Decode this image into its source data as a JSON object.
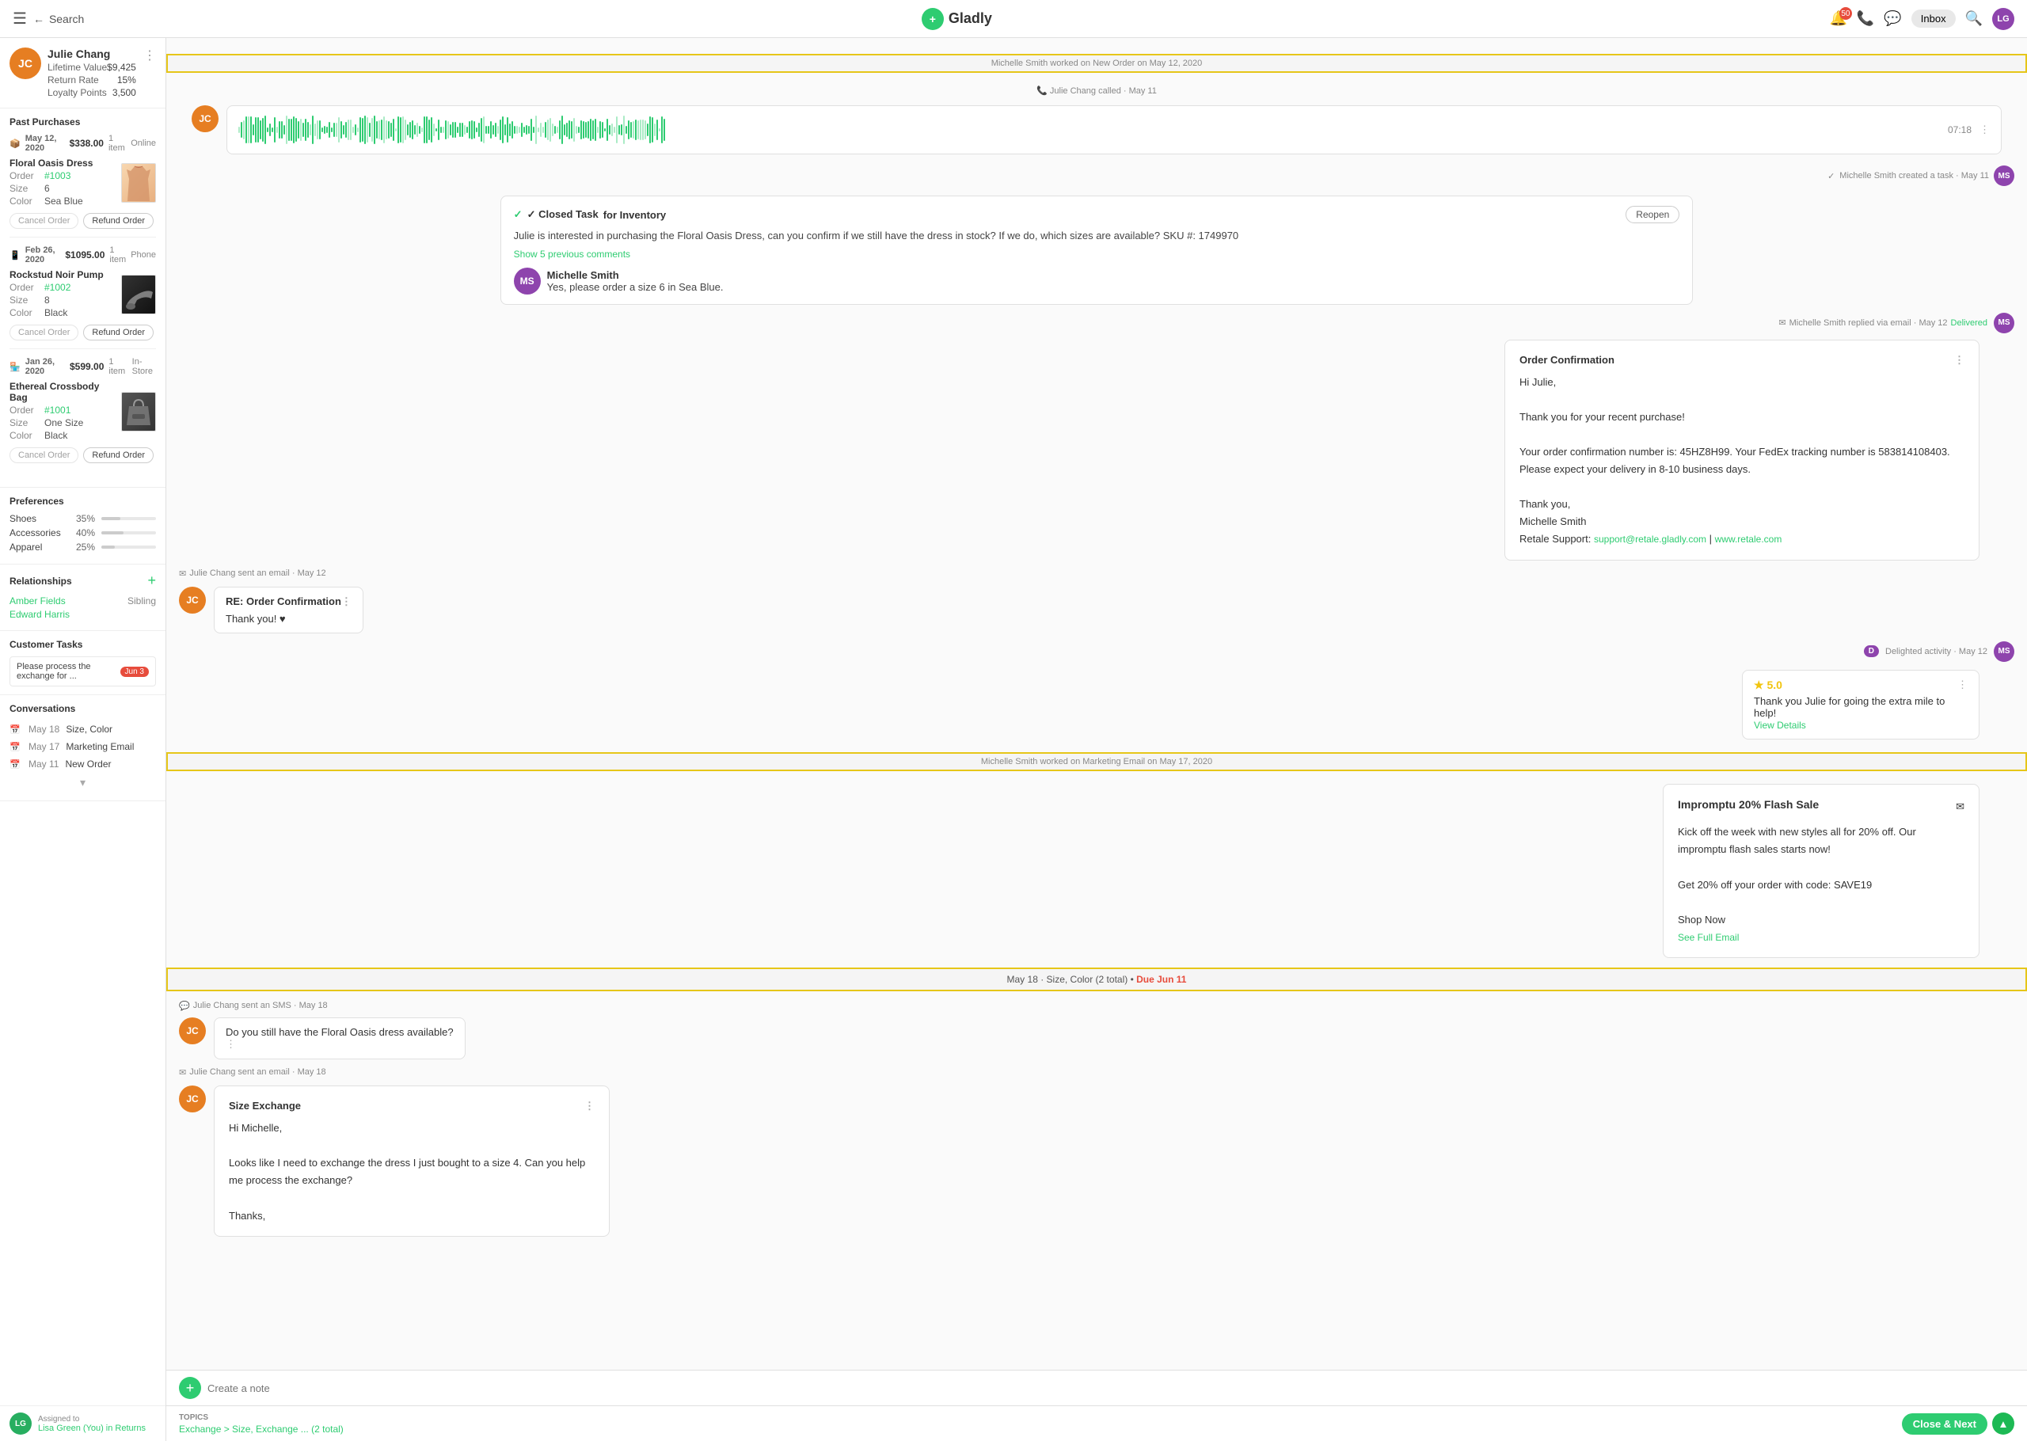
{
  "nav": {
    "hamburger": "☰",
    "search_label": "Search",
    "logo_text": "Gladly",
    "logo_icon": "+",
    "badge_count": "50",
    "inbox_label": "Inbox",
    "search_icon": "🔍"
  },
  "customer": {
    "name": "Julie Chang",
    "avatar_initials": "JC",
    "lifetime_value_label": "Lifetime Value",
    "lifetime_value": "$9,425",
    "return_rate_label": "Return Rate",
    "return_rate": "15%",
    "loyalty_label": "Loyalty Points",
    "loyalty": "3,500"
  },
  "past_purchases": {
    "title": "Past Purchases",
    "orders": [
      {
        "date": "May 12, 2020",
        "amount": "$338.00",
        "items": "1 item",
        "channel": "Online",
        "product": "Floral Oasis Dress",
        "order_label": "Order",
        "order_num": "#1003",
        "size_label": "Size",
        "size": "6",
        "color_label": "Color",
        "color": "Sea Blue",
        "cancel_label": "Cancel Order",
        "refund_label": "Refund Order"
      },
      {
        "date": "Feb 26, 2020",
        "amount": "$1095.00",
        "items": "1 item",
        "channel": "Phone",
        "product": "Rockstud Noir Pump",
        "order_label": "Order",
        "order_num": "#1002",
        "size_label": "Size",
        "size": "8",
        "color_label": "Color",
        "color": "Black",
        "cancel_label": "Cancel Order",
        "refund_label": "Refund Order"
      },
      {
        "date": "Jan 26, 2020",
        "amount": "$599.00",
        "items": "1 item",
        "channel": "In-Store",
        "product": "Ethereal Crossbody Bag",
        "order_label": "Order",
        "order_num": "#1001",
        "size_label": "Size",
        "size": "One Size",
        "color_label": "Color",
        "color": "Black",
        "cancel_label": "Cancel Order",
        "refund_label": "Refund Order"
      }
    ]
  },
  "preferences": {
    "title": "Preferences",
    "items": [
      {
        "label": "Shoes",
        "pct": "35%",
        "bar": 35
      },
      {
        "label": "Accessories",
        "pct": "40%",
        "bar": 40
      },
      {
        "label": "Apparel",
        "pct": "25%",
        "bar": 25
      }
    ]
  },
  "relationships": {
    "title": "Relationships",
    "items": [
      {
        "name": "Amber Fields",
        "type": "Sibling"
      },
      {
        "name": "Edward Harris",
        "type": ""
      }
    ]
  },
  "customer_tasks": {
    "title": "Customer Tasks",
    "task_text": "Please process the exchange for ...",
    "task_due": "Jun 3"
  },
  "conversations": {
    "title": "Conversations",
    "items": [
      {
        "date": "May 18",
        "subject": "Size, Color"
      },
      {
        "date": "May 17",
        "subject": "Marketing Email"
      },
      {
        "date": "May 11",
        "subject": "New Order"
      }
    ],
    "chevron_label": "▾"
  },
  "assigned": {
    "label": "Assigned to",
    "agent": "Lisa Green (You) in Returns"
  },
  "chat": {
    "divider1": "Michelle Smith worked on New Order on May 12, 2020",
    "call_meta": "Julie Chang called · May 11",
    "audio_time": "07:18",
    "task_created_meta": "Michelle Smith created a task · May 11",
    "closed_task_prefix": "✓ Closed Task",
    "closed_task_for": "for Inventory",
    "task_body": "Julie is interested in purchasing the Floral Oasis Dress, can you confirm if we still have the dress in stock? If we do, which sizes are available? SKU #: 1749970",
    "show_comments": "Show 5 previous comments",
    "reply_agent": "Michelle Smith",
    "reply_text": "Yes, please order a size 6 in Sea Blue.",
    "reopen_btn": "Reopen",
    "email_meta": "Michelle Smith replied via email · May 12",
    "delivered": "Delivered",
    "order_conf_title": "Order Confirmation",
    "email_greeting": "Hi Julie,",
    "email_thanks": "Thank you for your recent purchase!",
    "email_conf": "Your order confirmation number is: 45HZ8H99. Your FedEx tracking number is 583814108403. Please expect your delivery in 8-10 business days.",
    "email_sign_thanks": "Thank you,",
    "email_sign_name": "Michelle Smith",
    "email_sign_company": "Retale Support:",
    "email_link1": "support@retale.gladly.com",
    "email_link2": "www.retale.com",
    "julie_email_meta": "Julie Chang sent an email · May 12",
    "reply_subject": "RE: Order Confirmation",
    "reply_heart": "Thank you! ♥",
    "delighted_meta": "Delighted activity · May 12",
    "delighted_rating": "★ 5.0",
    "delighted_text": "Thank you Julie for going the extra mile to help!",
    "view_details": "View Details",
    "divider2": "Michelle Smith worked on Marketing Email on May 17, 2020",
    "flash_title": "Impromptu 20% Flash Sale",
    "flash_body": "Kick off the week with new styles all for 20% off. Our impromptu flash sales starts now!",
    "flash_promo": "Get 20% off your order with code: SAVE19",
    "flash_shop": "Shop Now",
    "flash_full_email": "See Full Email",
    "date_divider": "May 18 · Size, Color (2 total)",
    "due_label": "Due Jun 11",
    "sms_meta": "Julie Chang sent an SMS · May 18",
    "sms_text": "Do you still have the Floral Oasis dress available?",
    "email2_meta": "Julie Chang sent an email · May 18",
    "size_exchange_subject": "Size Exchange",
    "size_exchange_greeting": "Hi Michelle,",
    "size_exchange_body": "Looks like I need to exchange the dress I just bought to a size 4. Can you help me process the exchange?",
    "size_exchange_thanks": "Thanks,"
  },
  "bottom_bar": {
    "placeholder": "Create a note",
    "add_btn": "+"
  },
  "topics_bar": {
    "topics_label": "TOPICS",
    "topics_value": "Exchange > Size, Exchange ... (2 total)",
    "close_next_btn": "Close & Next",
    "chevron": "▲"
  }
}
